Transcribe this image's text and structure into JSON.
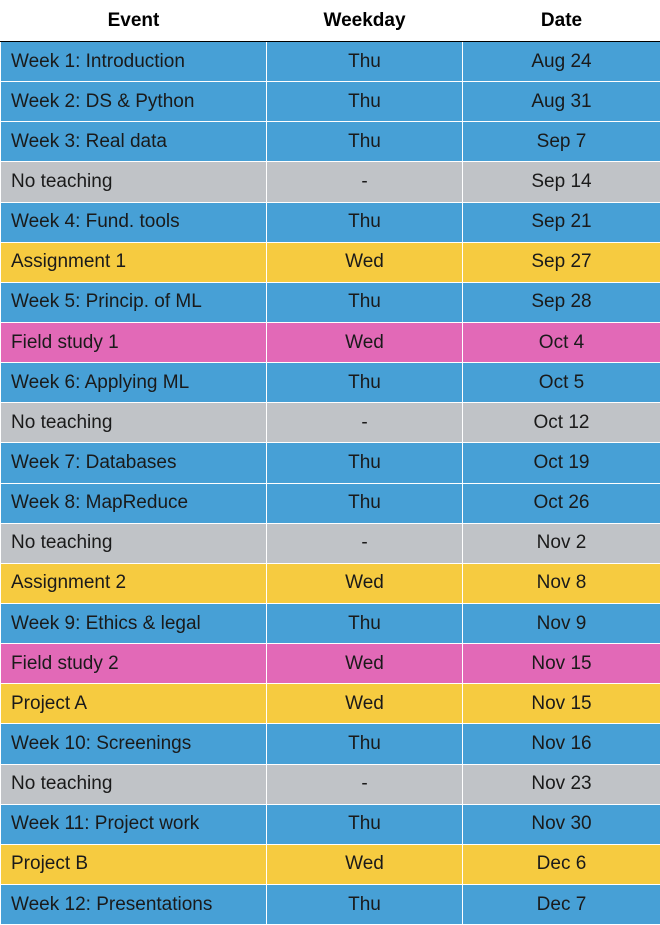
{
  "headers": {
    "event": "Event",
    "weekday": "Weekday",
    "date": "Date"
  },
  "colors": {
    "lecture": "#47a0d6",
    "none": "#c0c3c7",
    "assignment": "#f6cb40",
    "field": "#e269b7",
    "project": "#f6cb40"
  },
  "rows": [
    {
      "event": "Week 1: Introduction",
      "weekday": "Thu",
      "date": "Aug 24",
      "type": "lecture"
    },
    {
      "event": "Week 2: DS & Python",
      "weekday": "Thu",
      "date": "Aug 31",
      "type": "lecture"
    },
    {
      "event": "Week 3: Real data",
      "weekday": "Thu",
      "date": "Sep 7",
      "type": "lecture"
    },
    {
      "event": "No teaching",
      "weekday": "-",
      "date": "Sep 14",
      "type": "none"
    },
    {
      "event": "Week 4: Fund. tools",
      "weekday": "Thu",
      "date": "Sep 21",
      "type": "lecture"
    },
    {
      "event": "Assignment 1",
      "weekday": "Wed",
      "date": "Sep 27",
      "type": "assignment"
    },
    {
      "event": "Week 5: Princip. of ML",
      "weekday": "Thu",
      "date": "Sep 28",
      "type": "lecture"
    },
    {
      "event": "Field study 1",
      "weekday": "Wed",
      "date": "Oct 4",
      "type": "field"
    },
    {
      "event": "Week 6: Applying ML",
      "weekday": "Thu",
      "date": "Oct 5",
      "type": "lecture"
    },
    {
      "event": "No teaching",
      "weekday": "-",
      "date": "Oct 12",
      "type": "none"
    },
    {
      "event": "Week 7: Databases",
      "weekday": "Thu",
      "date": "Oct 19",
      "type": "lecture"
    },
    {
      "event": "Week 8: MapReduce",
      "weekday": "Thu",
      "date": "Oct 26",
      "type": "lecture"
    },
    {
      "event": "No teaching",
      "weekday": "-",
      "date": "Nov 2",
      "type": "none"
    },
    {
      "event": "Assignment 2",
      "weekday": "Wed",
      "date": "Nov 8",
      "type": "assignment"
    },
    {
      "event": "Week 9: Ethics & legal",
      "weekday": "Thu",
      "date": "Nov 9",
      "type": "lecture"
    },
    {
      "event": "Field study 2",
      "weekday": "Wed",
      "date": "Nov 15",
      "type": "field"
    },
    {
      "event": "Project A",
      "weekday": "Wed",
      "date": "Nov 15",
      "type": "project"
    },
    {
      "event": "Week 10: Screenings",
      "weekday": "Thu",
      "date": "Nov 16",
      "type": "lecture"
    },
    {
      "event": "No teaching",
      "weekday": "-",
      "date": "Nov 23",
      "type": "none"
    },
    {
      "event": "Week 11: Project work",
      "weekday": "Thu",
      "date": "Nov 30",
      "type": "lecture"
    },
    {
      "event": "Project B",
      "weekday": "Wed",
      "date": "Dec 6",
      "type": "project"
    },
    {
      "event": "Week 12: Presentations",
      "weekday": "Thu",
      "date": "Dec 7",
      "type": "lecture"
    }
  ]
}
